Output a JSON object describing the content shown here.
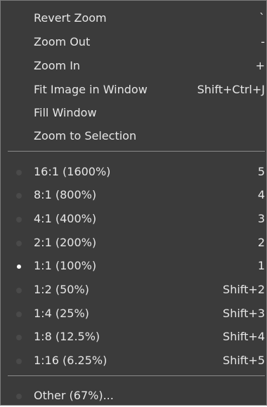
{
  "zoom_actions": [
    {
      "label": "Revert Zoom",
      "accel": "`"
    },
    {
      "label": "Zoom Out",
      "accel": "-"
    },
    {
      "label": "Zoom In",
      "accel": "+"
    },
    {
      "label": "Fit Image in Window",
      "accel": "Shift+Ctrl+J"
    },
    {
      "label": "Fill Window",
      "accel": ""
    },
    {
      "label": "Zoom to Selection",
      "accel": ""
    }
  ],
  "zoom_levels": [
    {
      "label": "16:1  (1600%)",
      "accel": "5",
      "selected": false
    },
    {
      "label": "8:1  (800%)",
      "accel": "4",
      "selected": false
    },
    {
      "label": "4:1  (400%)",
      "accel": "3",
      "selected": false
    },
    {
      "label": "2:1  (200%)",
      "accel": "2",
      "selected": false
    },
    {
      "label": "1:1  (100%)",
      "accel": "1",
      "selected": true
    },
    {
      "label": "1:2  (50%)",
      "accel": "Shift+2",
      "selected": false
    },
    {
      "label": "1:4  (25%)",
      "accel": "Shift+3",
      "selected": false
    },
    {
      "label": "1:8  (12.5%)",
      "accel": "Shift+4",
      "selected": false
    },
    {
      "label": "1:16  (6.25%)",
      "accel": "Shift+5",
      "selected": false
    }
  ],
  "other": {
    "label": "Other (67%)...",
    "selected": false
  },
  "colors": {
    "menu_background": "#3b3b3b",
    "text": "#e6e6e6",
    "radio_inactive": "#4a4a4a",
    "radio_active": "#ffffff",
    "separator": "#8a8a8a"
  }
}
